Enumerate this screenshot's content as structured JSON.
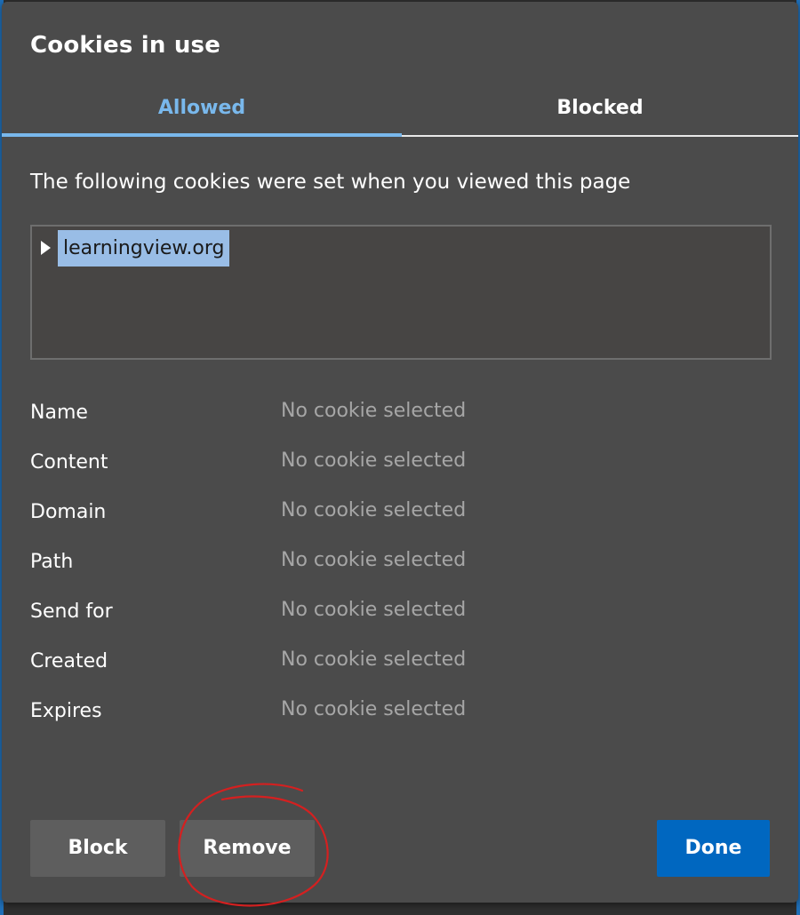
{
  "dialog": {
    "title": "Cookies in use",
    "tabs": [
      {
        "label": "Allowed",
        "active": true
      },
      {
        "label": "Blocked",
        "active": false
      }
    ],
    "description": "The following cookies were set when you viewed this page",
    "tree": {
      "items": [
        {
          "label": "learningview.org",
          "selected": true,
          "expanded": false
        }
      ]
    },
    "details": [
      {
        "label": "Name",
        "value": "No cookie selected"
      },
      {
        "label": "Content",
        "value": "No cookie selected"
      },
      {
        "label": "Domain",
        "value": "No cookie selected"
      },
      {
        "label": "Path",
        "value": "No cookie selected"
      },
      {
        "label": "Send for",
        "value": "No cookie selected"
      },
      {
        "label": "Created",
        "value": "No cookie selected"
      },
      {
        "label": "Expires",
        "value": "No cookie selected"
      }
    ],
    "buttons": {
      "block": "Block",
      "remove": "Remove",
      "done": "Done"
    }
  },
  "colors": {
    "dialog_bg": "#4b4b4b",
    "accent": "#79b8ec",
    "primary_button": "#0067c0",
    "secondary_button": "#5e5e5e",
    "selection": "#99bde6",
    "muted_text": "#a6a6a6",
    "annotation": "#d42020"
  }
}
